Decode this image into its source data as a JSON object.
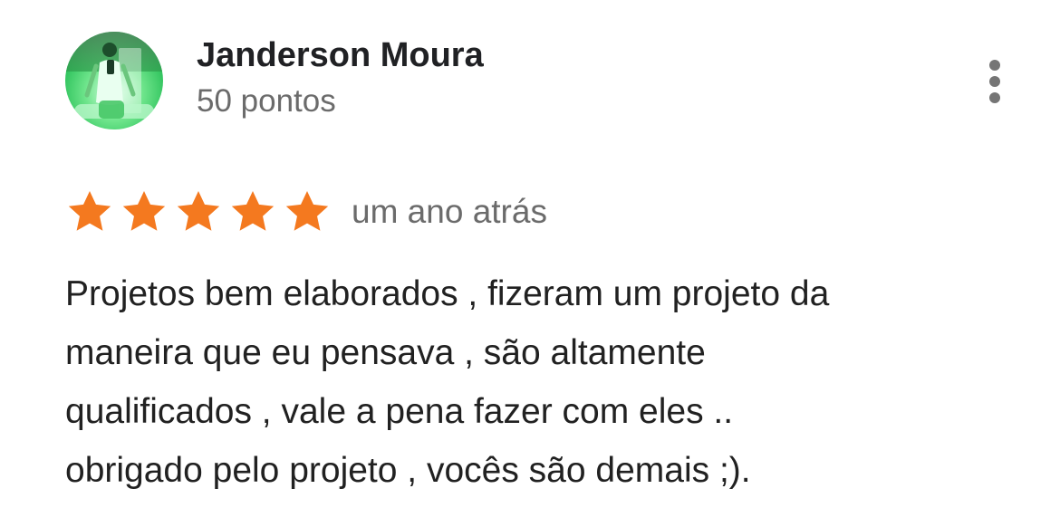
{
  "review": {
    "author_name": "Janderson Moura",
    "author_points": "50 pontos",
    "rating": 5,
    "rating_max": 5,
    "time": "um ano atrás",
    "text_lines": [
      "Projetos bem elaborados , fizeram um projeto da",
      "maneira que eu pensava , são altamente",
      "qualificados , vale a pena fazer com eles ..",
      "obrigado pelo projeto , vocês são demais ;)."
    ]
  },
  "icons": {
    "avatar": "user-photo-avatar",
    "menu": "more-vert-icon",
    "star": "star-icon"
  },
  "colors": {
    "star_fill": "#F4791F",
    "name_text": "#202124",
    "secondary_text": "#6B6B6B",
    "body_text": "#212121",
    "avatar_accent": "#22C55E"
  }
}
